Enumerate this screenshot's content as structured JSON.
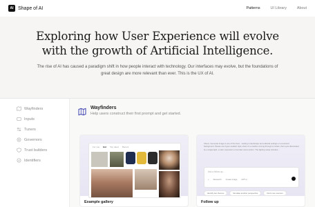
{
  "header": {
    "logo_badge": "AI",
    "logo_text": "Shape of AI",
    "nav": [
      "Patterns",
      "UI Library",
      "About"
    ]
  },
  "hero": {
    "title": "Exploring how User Experience will evolve with the growth of Artificial Intelligence.",
    "subtitle": "The rise of AI has caused a paradigm shift in how people interact with technology. Our interfaces may evolve, but the foundations of great design are more relevant than ever. This is the UX of AI."
  },
  "sidebar": {
    "items": [
      {
        "label": "Wayfinders",
        "icon": "map-icon"
      },
      {
        "label": "Inputs",
        "icon": "input-icon"
      },
      {
        "label": "Tuners",
        "icon": "tuner-icon"
      },
      {
        "label": "Governors",
        "icon": "governor-icon"
      },
      {
        "label": "Trust builders",
        "icon": "shield-icon"
      },
      {
        "label": "Identifiers",
        "icon": "identifier-icon"
      }
    ]
  },
  "section": {
    "title": "Wayfinders",
    "description": "Help users construct their first prompt and get started."
  },
  "cards": [
    {
      "label": "Example gallery",
      "tabs": [
        "For you",
        "Hot",
        "Top rated",
        "Recent"
      ]
    },
    {
      "label": "Follow up",
      "chat_text": "Above, Generate image is one of the best... looking in landscape and editorial settings on a textured background. Please use hyper-realistic style shots of a creative coming through a curtain, their eyes illuminated by a single light, a calm expression of wonder and emotion. The lighting setup includes...",
      "placeholder": "Ask a follow up...",
      "tools": [
        "+",
        "Research",
        "Create image",
        "GPT-4"
      ],
      "chips": [
        "Identify two themes",
        "Simulate another perspective",
        "Find more sources"
      ]
    }
  ],
  "colors": {
    "hero_bg": "#f6f5f3",
    "main_bg": "#f9f9f8",
    "card_gradient": "#ebe8f5"
  }
}
